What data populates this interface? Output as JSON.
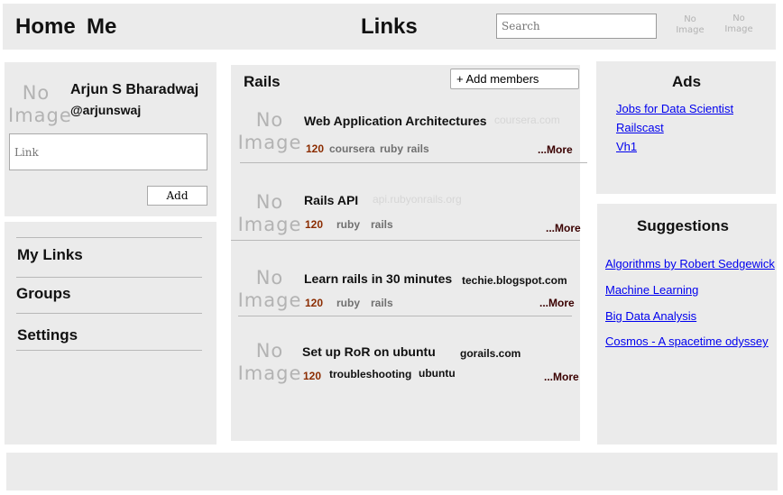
{
  "header": {
    "home": "Home",
    "me": "Me",
    "title": "Links",
    "search_placeholder": "Search",
    "no_image_line1": "No",
    "no_image_line2": "Image"
  },
  "profile": {
    "name": "Arjun S Bharadwaj",
    "handle": "@arjunswaj",
    "link_placeholder": "Link",
    "add_label": "Add"
  },
  "menu": {
    "items": [
      "My Links",
      "Groups",
      "Settings"
    ]
  },
  "group": {
    "name": "Rails",
    "add_members_label": "+ Add members"
  },
  "links": [
    {
      "title": "Web Application Architectures",
      "domain": "coursera.com",
      "count": "120",
      "tags": [
        "coursera",
        "ruby",
        "rails"
      ],
      "more": "...More"
    },
    {
      "title": "Rails API",
      "domain": "api.rubyonrails.org",
      "count": "120",
      "tags": [
        "ruby",
        "rails"
      ],
      "more": "...More"
    },
    {
      "title": "Learn rails in 30 minutes",
      "domain": "techie.blogspot.com",
      "count": "120",
      "tags": [
        "ruby",
        "rails"
      ],
      "more": "...More"
    },
    {
      "title": "Set up RoR on ubuntu",
      "domain": "gorails.com",
      "count": "120",
      "tags": [
        "troubleshooting",
        "ubuntu"
      ],
      "more": "...More"
    }
  ],
  "ads": {
    "title": "Ads",
    "items": [
      "Jobs for Data Scientists",
      "Railscast",
      "Vh1"
    ]
  },
  "suggestions": {
    "title": "Suggestions",
    "items": [
      "Algorithms by Robert Sedgewick",
      "Machine Learning",
      "Big Data Analysis",
      "Cosmos - A spacetime odyssey"
    ]
  }
}
